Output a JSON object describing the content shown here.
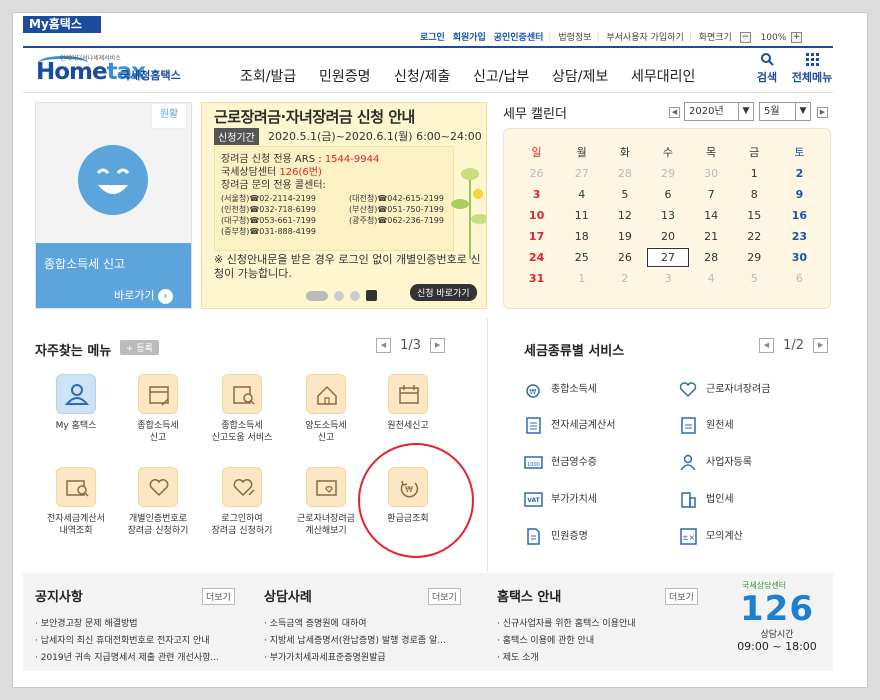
{
  "header": {
    "my_hometax": "My홈택스",
    "links": [
      "로그인",
      "회원가입",
      "공인인증센터",
      "법령정보",
      "부서사용자 가입하기",
      "화면크기"
    ],
    "zoom_minus": "−",
    "zoom_value": "100%",
    "zoom_plus": "+"
  },
  "logo": {
    "tagline": "언제어디서나세제서비스",
    "word_home": "Home",
    "word_tax": "tax",
    "agency": "국세청홈택스"
  },
  "nav": {
    "items": [
      "조회/발급",
      "민원증명",
      "신청/제출",
      "신고/납부",
      "상담/제보",
      "세무대리인"
    ],
    "search_label": "검색",
    "all_menu_label": "전체메뉴"
  },
  "left_card": {
    "badge": "원활",
    "title": "종합소득세 신고",
    "button": "바로가기"
  },
  "banner": {
    "title": "근로장려금·자녀장려금 신청 안내",
    "period_tag": "신청기간",
    "period": "2020.5.1(금)~2020.6.1(월) 6:00~24:00",
    "lines": [
      {
        "text": "장려금 신청 전용 ARS : ",
        "accent": "1544-9944"
      },
      {
        "text": "국세상담센터 ",
        "accent": "126(6번)"
      },
      {
        "text": "장려금 문의 전용 콜센터:",
        "accent": ""
      }
    ],
    "phones": [
      [
        "(서울청)☎02-2114-2199",
        "(대전청)☎042-615-2199"
      ],
      [
        "(인천청)☎032-718-6199",
        "(부산청)☎051-750-7199"
      ],
      [
        "(대구청)☎053-661-7199",
        "(광주청)☎062-236-7199"
      ],
      [
        "(중부청)☎031-888-4199",
        ""
      ]
    ],
    "note": "※ 신청안내문을 받은 경우 로그인 없이 개별인증번호로 신청이 가능합니다.",
    "shortcut": "신청 바로가기"
  },
  "calendar": {
    "title": "세무 캘린더",
    "year": "2020년",
    "month": "5월",
    "weekdays": [
      "일",
      "월",
      "화",
      "수",
      "목",
      "금",
      "토"
    ],
    "weeks": [
      [
        "26",
        "27",
        "28",
        "29",
        "30",
        "1",
        "2"
      ],
      [
        "3",
        "4",
        "5",
        "6",
        "7",
        "8",
        "9"
      ],
      [
        "10",
        "11",
        "12",
        "13",
        "14",
        "15",
        "16"
      ],
      [
        "17",
        "18",
        "19",
        "20",
        "21",
        "22",
        "23"
      ],
      [
        "24",
        "25",
        "26",
        "27",
        "28",
        "29",
        "30"
      ],
      [
        "31",
        "1",
        "2",
        "3",
        "4",
        "5",
        "6"
      ]
    ],
    "today": "27"
  },
  "favorites": {
    "title": "자주찾는 메뉴",
    "register": "+ 등록",
    "page": "1/3",
    "items": [
      [
        "My 홈택스",
        ""
      ],
      [
        "종합소득세",
        "신고"
      ],
      [
        "종합소득세",
        "신고도움 서비스"
      ],
      [
        "양도소득세",
        "신고"
      ],
      [
        "원천세신고",
        ""
      ],
      [
        "전자세금계산서",
        "내역조회"
      ],
      [
        "개별인증번호로",
        "장려금 신청하기"
      ],
      [
        "로그인하여",
        "장려금 신청하기"
      ],
      [
        "근로자녀장려금",
        "계산해보기"
      ],
      [
        "환급금조회",
        ""
      ]
    ]
  },
  "services": {
    "title": "세금종류별 서비스",
    "page": "1/2",
    "items": [
      "종합소득세",
      "근로자녀장려금",
      "전자세금계산서",
      "원천세",
      "현금영수증",
      "사업자등록",
      "부가가치세",
      "법인세",
      "민원증명",
      "모의계산"
    ]
  },
  "notices": {
    "title": "공지사항",
    "more": "더보기",
    "items": [
      "보안경고창 문제 해결방법",
      "납세자의 최신 휴대전화번호로 전자고지 안내",
      "2019년 귀속 지급명세서 제출 관련 개선사항..."
    ]
  },
  "cases": {
    "title": "상담사례",
    "more": "더보기",
    "items": [
      "소득금액 증명원에 대하여",
      "지방세 납세증명서(완납증명) 발행 경로좀 알...",
      "부가가치세과세표준증명원발급"
    ]
  },
  "guide": {
    "title": "홈택스 안내",
    "more": "더보기",
    "items": [
      "신규사업자를 위한 홈택스 이용안내",
      "홈택스 이용에 관한 안내",
      "제도 소개"
    ]
  },
  "call_center": {
    "label": "국세상담센터",
    "number": "126",
    "hours_label": "상담시간",
    "hours": "09:00 ~ 18:00"
  },
  "colors": {
    "brand": "#1a4d9c",
    "accent_red": "#e4232e",
    "sky": "#5ba5dc",
    "sunday": "#e4232e",
    "saturday": "#1a56b0"
  }
}
